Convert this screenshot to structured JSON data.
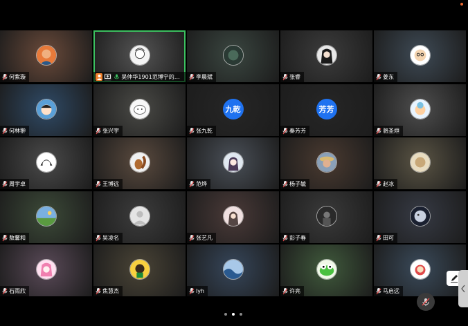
{
  "participants": [
    {
      "name": "何紫璇",
      "avatar": "orange-portrait",
      "tile": "#6a4a3a"
    },
    {
      "name": "吴仲华1901范博宁的屏...",
      "avatar": "sketch-portrait",
      "tile": "#545454",
      "active": true,
      "host": true
    },
    {
      "name": "李晨斌",
      "avatar": "dark-portrait",
      "tile": "#3a4640"
    },
    {
      "name": "张睿",
      "avatar": "anime-dark-hair",
      "tile": "#3c3c3c"
    },
    {
      "name": "姜东",
      "avatar": "cartoon-glasses",
      "tile": "#3e4a55"
    },
    {
      "name": "何林翀",
      "avatar": "cartoon-boy",
      "tile": "#2f4a66"
    },
    {
      "name": "张兴宇",
      "avatar": "white-doodle",
      "tile": "#4a4a46"
    },
    {
      "name": "张九乾",
      "avatar_text": "九乾",
      "tile": "#262626"
    },
    {
      "name": "秦芳芳",
      "avatar_text": "芳芳",
      "tile": "#262626"
    },
    {
      "name": "骆圣烜",
      "avatar": "cartoon-cloud",
      "tile": "#4e4e4e"
    },
    {
      "name": "周宇卓",
      "avatar": "manga-boy",
      "tile": "#4a4a4a"
    },
    {
      "name": "王博远",
      "avatar": "squirrel",
      "tile": "#5a4a3e"
    },
    {
      "name": "范烨",
      "avatar": "anime-girl",
      "tile": "#4a5058"
    },
    {
      "name": "杨子毓",
      "avatar": "straw-hat",
      "tile": "#4a3a30"
    },
    {
      "name": "赵冰",
      "avatar": "beige-photo",
      "tile": "#5a5444"
    },
    {
      "name": "敖馨和",
      "avatar": "landscape",
      "tile": "#3c4a38"
    },
    {
      "name": "吴凌名",
      "avatar": "default-user",
      "tile": "#3c3c3c"
    },
    {
      "name": "张艺凡",
      "avatar": "girl-photo",
      "tile": "#4a3a38"
    },
    {
      "name": "彭子春",
      "avatar": "dark-figure",
      "tile": "#3a3a3a"
    },
    {
      "name": "田可",
      "avatar": "moon-face",
      "tile": "#363a44"
    },
    {
      "name": "石雨欣",
      "avatar": "pink-anime",
      "tile": "#5a4a58"
    },
    {
      "name": "焦慧杰",
      "avatar": "cartoon-dog",
      "tile": "#4a4436"
    },
    {
      "name": "lyh",
      "avatar": "blue-wave",
      "tile": "#36465a"
    },
    {
      "name": "许亮",
      "avatar": "green-frog",
      "tile": "#405a3c"
    },
    {
      "name": "马启远",
      "avatar": "cartoon-bear",
      "tile": "#3a4a5a"
    }
  ],
  "pagination": {
    "pages": 3,
    "current": 2
  },
  "colors": {
    "active_border": "#3cc060",
    "text_avatar_bg": "#1f72f0",
    "host_badge": "#f0812c",
    "notification": "#e8672f"
  },
  "controls": {
    "mute_icon": "muted-mic-icon",
    "pen_icon": "pen-icon",
    "side_tab_icon": "chevron-left-icon"
  }
}
